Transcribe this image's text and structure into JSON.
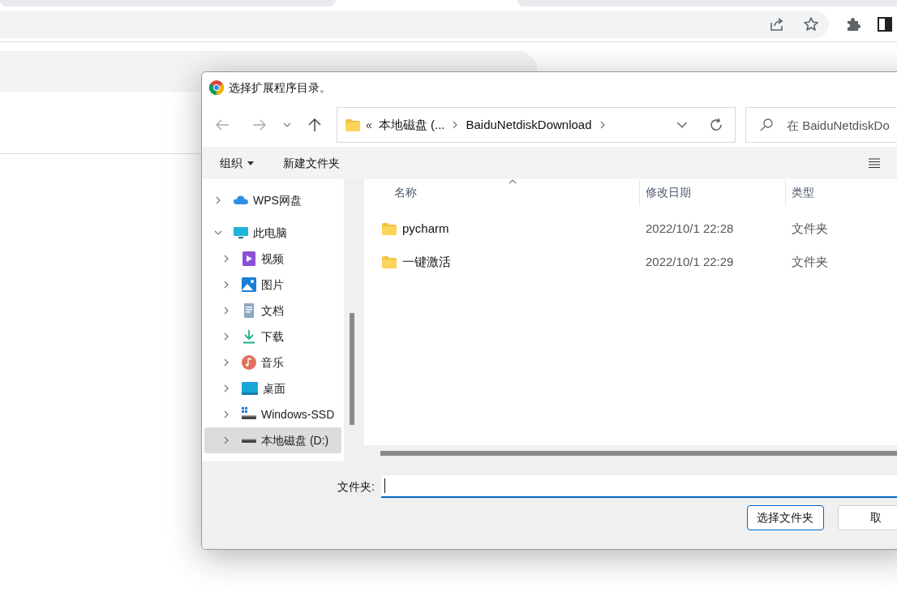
{
  "dialog": {
    "title": "选择扩展程序目录。",
    "address": {
      "overflow": "«",
      "crumbs": [
        "本地磁盘 (...",
        "BaiduNetdiskDownload"
      ]
    },
    "search": {
      "placeholder": "在 BaiduNetdiskDo"
    },
    "toolbar": [
      {
        "label": "组织",
        "kind": "menu"
      },
      {
        "label": "新建文件夹",
        "kind": "button"
      }
    ],
    "nav": [
      {
        "label": "WPS网盘",
        "kind": "cloud",
        "expanded": false,
        "selected": false
      },
      {
        "label": "此电脑",
        "kind": "pc",
        "expanded": true,
        "selected": false,
        "children": [
          {
            "label": "视频",
            "kind": "video",
            "expanded": false,
            "selected": false
          },
          {
            "label": "图片",
            "kind": "image",
            "expanded": false,
            "selected": false
          },
          {
            "label": "文档",
            "kind": "doc",
            "expanded": false,
            "selected": false
          },
          {
            "label": "下载",
            "kind": "download",
            "expanded": false,
            "selected": false
          },
          {
            "label": "音乐",
            "kind": "music",
            "expanded": false,
            "selected": false
          },
          {
            "label": "桌面",
            "kind": "desktop",
            "expanded": false,
            "selected": false
          },
          {
            "label": "Windows-SSD",
            "kind": "ssd",
            "expanded": false,
            "selected": false
          },
          {
            "label": "本地磁盘 (D:)",
            "kind": "drive",
            "expanded": false,
            "selected": true
          }
        ]
      }
    ],
    "columns": [
      {
        "label": "名称",
        "sorted": true
      },
      {
        "label": "修改日期",
        "sorted": false
      },
      {
        "label": "类型",
        "sorted": false
      }
    ],
    "rows": [
      {
        "name": "pycharm",
        "modified": "2022/10/1 22:28",
        "type": "文件夹"
      },
      {
        "name": "一键激活",
        "modified": "2022/10/1 22:29",
        "type": "文件夹"
      }
    ],
    "folder_label": "文件夹:",
    "buttons": [
      {
        "label": "选择文件夹",
        "primary": true
      },
      {
        "label": "取",
        "primary": false
      }
    ]
  }
}
